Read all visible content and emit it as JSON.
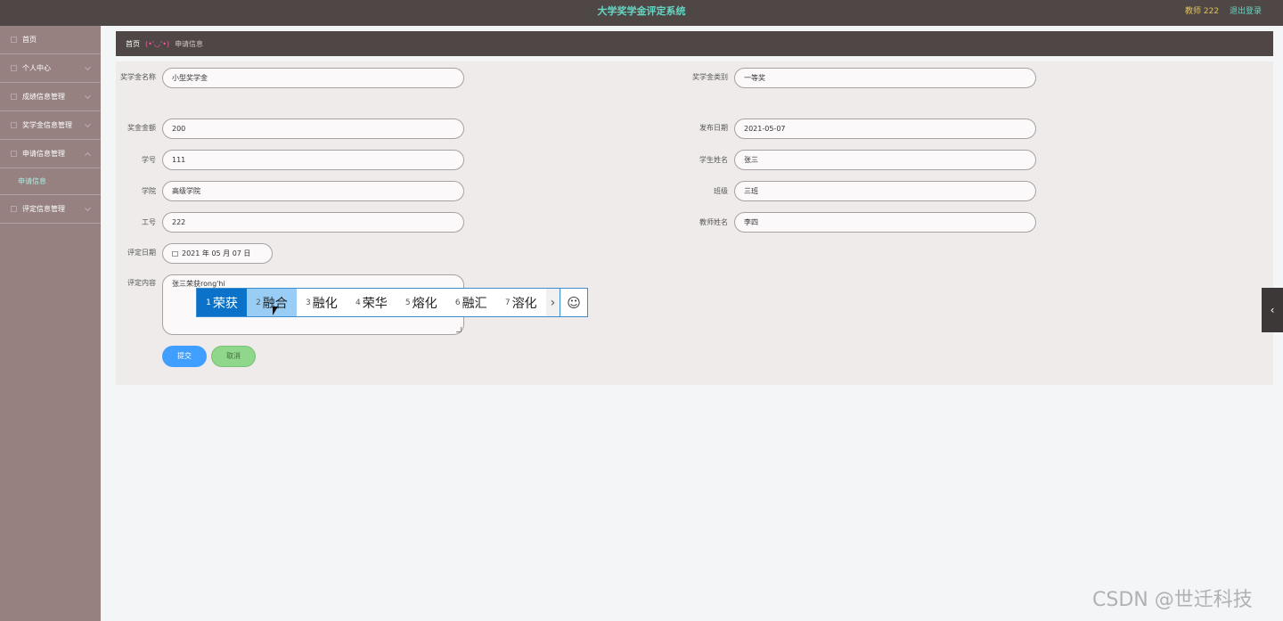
{
  "header": {
    "title": "大学奖学金评定系统",
    "user_label": "教师 222",
    "logout_label": "退出登录"
  },
  "sidebar": {
    "items": [
      {
        "label": "首页",
        "icon": "home-icon"
      },
      {
        "label": "个人中心",
        "icon": "user-icon"
      },
      {
        "label": "成绩信息管理",
        "icon": "list-icon"
      },
      {
        "label": "奖学金信息管理",
        "icon": "list-icon"
      },
      {
        "label": "申请信息管理",
        "icon": "list-icon"
      },
      {
        "label": "评定信息管理",
        "icon": "list-icon"
      }
    ],
    "sub_item": "申请信息"
  },
  "breadcrumb": {
    "home": "首页",
    "face": "(•'◡'•)",
    "current": "申请信息"
  },
  "form": {
    "name_label": "奖学金名称",
    "name_value": "小型奖学金",
    "category_label": "奖学金类别",
    "category_value": "一等奖",
    "amount_label": "奖金金额",
    "amount_value": "200",
    "publish_date_label": "发布日期",
    "publish_date_value": "2021-05-07",
    "student_id_label": "学号",
    "student_id_value": "111",
    "student_name_label": "学生姓名",
    "student_name_value": "张三",
    "college_label": "学院",
    "college_value": "高级学院",
    "class_label": "班级",
    "class_value": "三班",
    "job_no_label": "工号",
    "job_no_value": "222",
    "teacher_name_label": "教师姓名",
    "teacher_name_value": "李四",
    "eval_date_label": "评定日期",
    "eval_date_value": "2021 年 05 月 07 日",
    "content_label": "评定内容",
    "content_value": "张三荣获rong'hi"
  },
  "buttons": {
    "submit": "提交",
    "cancel": "取消"
  },
  "ime": {
    "candidates": [
      {
        "n": "1",
        "text": "荣获"
      },
      {
        "n": "2",
        "text": "融合"
      },
      {
        "n": "3",
        "text": "融化"
      },
      {
        "n": "4",
        "text": "荣华"
      },
      {
        "n": "5",
        "text": "熔化"
      },
      {
        "n": "6",
        "text": "融汇"
      },
      {
        "n": "7",
        "text": "溶化"
      }
    ],
    "more": "›",
    "emoji": "☺"
  },
  "side_toggle": "‹",
  "watermark": "CSDN @世迁科技"
}
